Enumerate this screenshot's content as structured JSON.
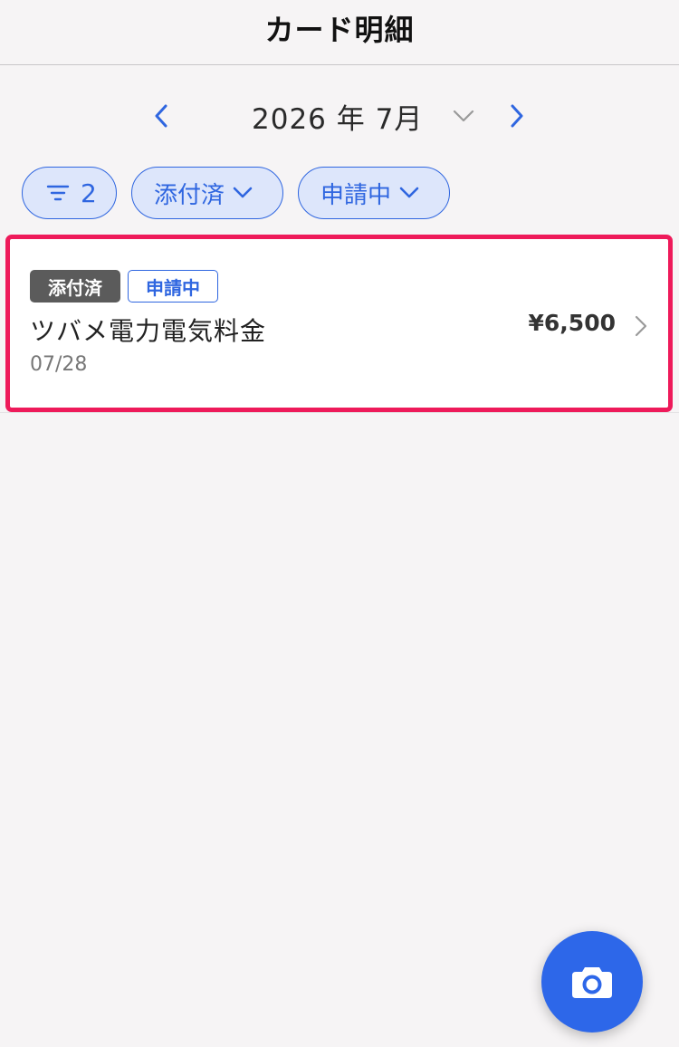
{
  "header": {
    "title": "カード明細"
  },
  "month_nav": {
    "prev_icon": "chevron-left-icon",
    "month_label": "2026 年 7月",
    "caret_icon": "chevron-down-icon",
    "next_icon": "chevron-right-icon"
  },
  "filters": {
    "filter_icon": "filter-lines-icon",
    "filter_count": "2",
    "attached_label": "添付済",
    "status_label": "申請中"
  },
  "transactions": [
    {
      "badges": {
        "attached": "添付済",
        "status": "申請中"
      },
      "merchant": "ツバメ電力電気料金",
      "date": "07/28",
      "amount": "¥6,500"
    }
  ],
  "fab": {
    "icon": "camera-icon"
  },
  "colors": {
    "accent": "#2f66e0",
    "chip_background": "#dde6fb",
    "highlight_border": "#ee1a5a",
    "attached_badge": "#5b5b5b",
    "fab": "#2d67e9",
    "page_background": "#f6f4f5"
  }
}
